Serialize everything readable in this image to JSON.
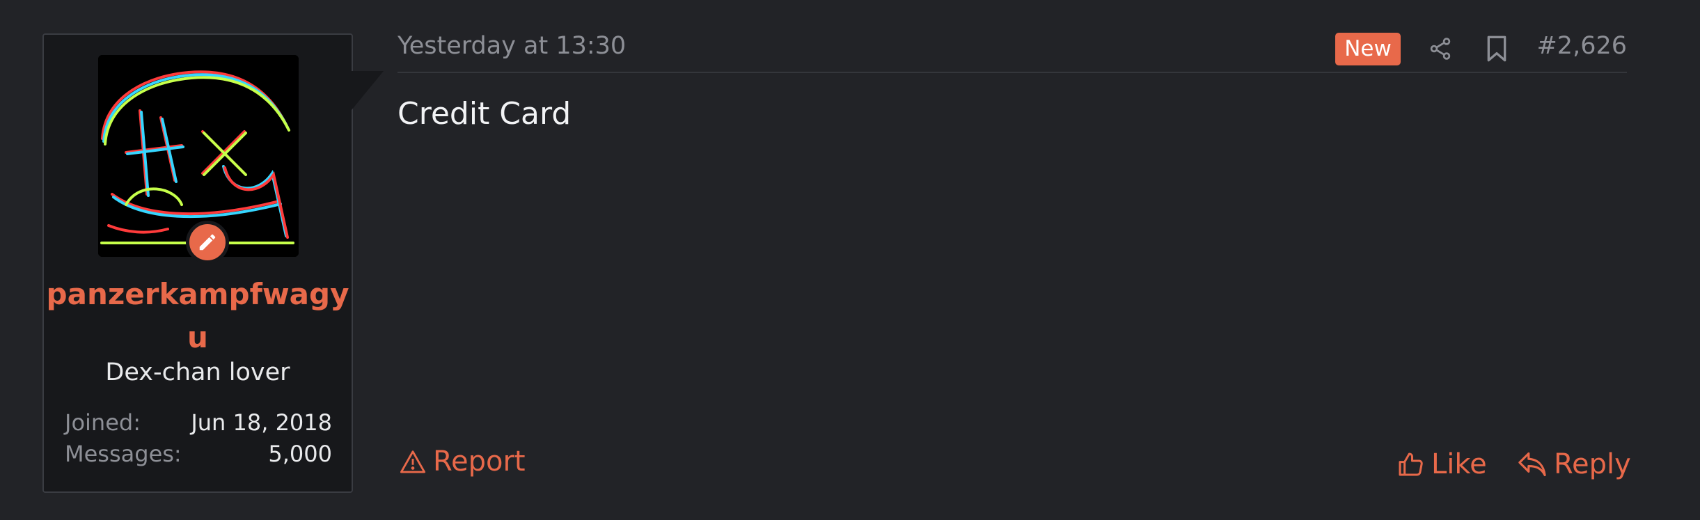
{
  "user": {
    "username": "panzerkampfwagyu",
    "title": "Dex-chan lover",
    "stats": [
      {
        "label": "Joined:",
        "value": "Jun 18, 2018"
      },
      {
        "label": "Messages:",
        "value": "5,000"
      }
    ],
    "avatar_badge_icon": "pencil-icon"
  },
  "post": {
    "date": "Yesterday at 13:30",
    "new_label": "New",
    "share_icon": "share-icon",
    "bookmark_icon": "bookmark-icon",
    "number": "#2,626",
    "body": "Credit Card"
  },
  "actions": {
    "report": "Report",
    "like": "Like",
    "reply": "Reply"
  },
  "colors": {
    "background": "#222327",
    "card": "#17181b",
    "accent": "#e8694a",
    "muted": "#8d8f96",
    "text": "#f2f3f5"
  }
}
